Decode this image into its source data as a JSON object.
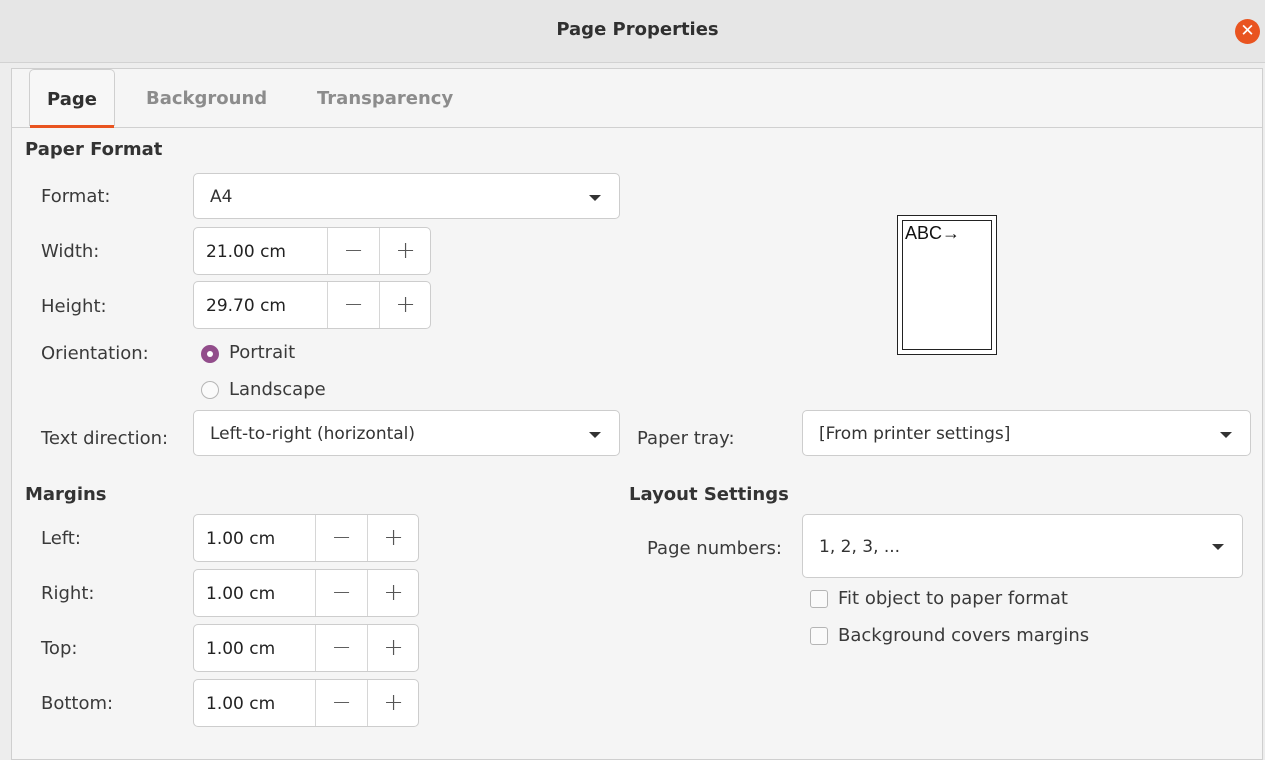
{
  "window": {
    "title": "Page Properties"
  },
  "tabs": [
    {
      "label": "Page",
      "active": true
    },
    {
      "label": "Background",
      "active": false
    },
    {
      "label": "Transparency",
      "active": false
    }
  ],
  "paper_format": {
    "heading": "Paper Format",
    "format_label": "Format:",
    "format_value": "A4",
    "width_label": "Width:",
    "width_value": "21.00 cm",
    "height_label": "Height:",
    "height_value": "29.70 cm",
    "orientation_label": "Orientation:",
    "portrait_label": "Portrait",
    "landscape_label": "Landscape",
    "selected_orientation": "Portrait",
    "text_direction_label": "Text direction:",
    "text_direction_value": "Left-to-right (horizontal)",
    "paper_tray_label": "Paper tray:",
    "paper_tray_value": "[From printer settings]",
    "preview_text": "ABC→"
  },
  "margins": {
    "heading": "Margins",
    "left_label": "Left:",
    "left_value": "1.00 cm",
    "right_label": "Right:",
    "right_value": "1.00 cm",
    "top_label": "Top:",
    "top_value": "1.00 cm",
    "bottom_label": "Bottom:",
    "bottom_value": "1.00 cm"
  },
  "layout_settings": {
    "heading": "Layout Settings",
    "page_numbers_label": "Page numbers:",
    "page_numbers_value": "1, 2, 3, ...",
    "fit_object_label": "Fit object to paper format",
    "fit_object_checked": false,
    "bg_covers_label": "Background covers margins",
    "bg_covers_checked": false
  },
  "spin_symbols": {
    "minus": "−",
    "plus": "+"
  },
  "icons": {
    "close": "close-icon",
    "dropdown": "chevron-down-icon"
  },
  "colors": {
    "accent": "#e95420",
    "radio_selected": "#924d8b"
  }
}
